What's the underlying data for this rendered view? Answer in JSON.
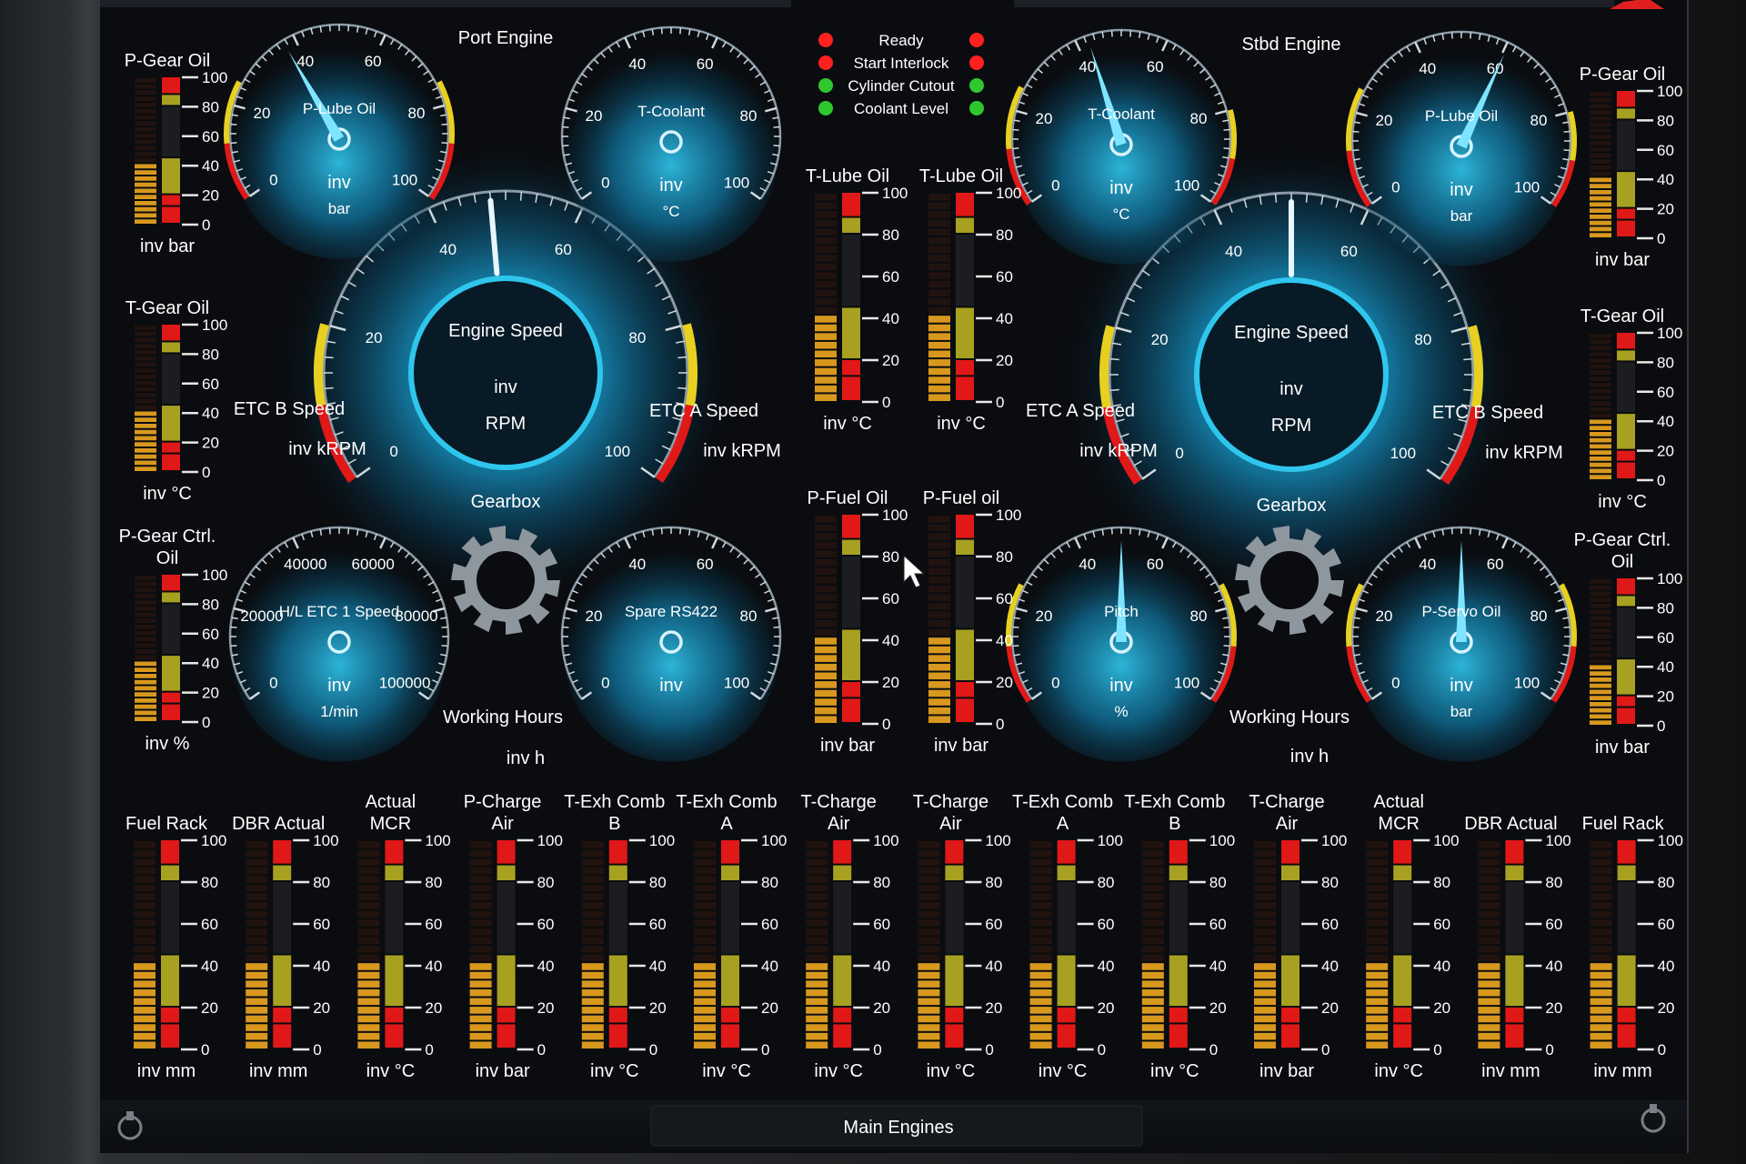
{
  "screen_title": "Main Engines",
  "status_indicators": [
    {
      "label": "Ready",
      "left_color": "#ff2020",
      "right_color": "#ff2020"
    },
    {
      "label": "Start Interlock",
      "left_color": "#ff2020",
      "right_color": "#ff2020"
    },
    {
      "label": "Cylinder Cutout",
      "left_color": "#2ec82e",
      "right_color": "#2ec82e"
    },
    {
      "label": "Coolant Level",
      "left_color": "#2ec82e",
      "right_color": "#2ec82e"
    }
  ],
  "port": {
    "title": "Port Engine",
    "engine_speed": {
      "label": "Engine Speed",
      "value": "inv",
      "unit": "RPM",
      "ticks": [
        "0",
        "20",
        "40",
        "60",
        "80",
        "100"
      ],
      "needle": 0.48
    },
    "etc_left": {
      "label": "ETC B Speed",
      "value": "inv kRPM"
    },
    "etc_right": {
      "label": "ETC A Speed",
      "value": "inv kRPM"
    },
    "gearbox_label": "Gearbox",
    "working_hours": {
      "label": "Working Hours",
      "value": "inv h"
    },
    "gauge_lube": {
      "label": "P-Lube Oil",
      "value": "inv",
      "unit": "bar",
      "ticks": [
        "0",
        "20",
        "40",
        "60",
        "80",
        "100"
      ],
      "needle": 0.38
    },
    "gauge_coolant": {
      "label": "T-Coolant",
      "value": "inv",
      "unit": "°C",
      "ticks": [
        "0",
        "20",
        "40",
        "60",
        "80",
        "100"
      ],
      "needle": null
    },
    "gauge_etc1": {
      "label": "H/L ETC 1 Speed",
      "value": "inv",
      "unit": "1/min",
      "ticks": [
        "0",
        "20000",
        "40000",
        "60000",
        "80000",
        "100000"
      ],
      "needle": null
    },
    "gauge_rs422": {
      "label": "Spare RS422",
      "value": "inv",
      "unit": "",
      "ticks": [
        "0",
        "20",
        "40",
        "60",
        "80",
        "100"
      ],
      "needle": null
    }
  },
  "stbd": {
    "title": "Stbd Engine",
    "engine_speed": {
      "label": "Engine Speed",
      "value": "inv",
      "unit": "RPM",
      "ticks": [
        "0",
        "20",
        "40",
        "60",
        "80",
        "100"
      ],
      "needle": 0.5
    },
    "etc_left": {
      "label": "ETC A Speed",
      "value": "inv kRPM"
    },
    "etc_right": {
      "label": "ETC B Speed",
      "value": "inv kRPM"
    },
    "gearbox_label": "Gearbox",
    "working_hours": {
      "label": "Working Hours",
      "value": "inv h"
    },
    "gauge_coolant": {
      "label": "T-Coolant",
      "value": "inv",
      "unit": "°C",
      "ticks": [
        "0",
        "20",
        "40",
        "60",
        "80",
        "100"
      ],
      "needle": 0.43
    },
    "gauge_lube": {
      "label": "P-Lube Oil",
      "value": "inv",
      "unit": "bar",
      "ticks": [
        "0",
        "20",
        "40",
        "60",
        "80",
        "100"
      ],
      "needle": 0.6
    },
    "gauge_pitch": {
      "label": "Pitch",
      "value": "inv",
      "unit": "%",
      "ticks": [
        "0",
        "20",
        "40",
        "60",
        "80",
        "100"
      ],
      "needle": 0.5
    },
    "gauge_servo": {
      "label": "P-Servo Oil",
      "value": "inv",
      "unit": "bar",
      "ticks": [
        "0",
        "20",
        "40",
        "60",
        "80",
        "100"
      ],
      "needle": 0.5
    }
  },
  "bar_scale": [
    "0",
    "20",
    "40",
    "60",
    "80",
    "100"
  ],
  "side_bars": {
    "left": [
      {
        "label": "P-Gear Oil",
        "value": "inv bar"
      },
      {
        "label": "T-Gear Oil",
        "value": "inv °C"
      },
      {
        "label": "P-Gear Ctrl. Oil",
        "value": "inv %"
      }
    ],
    "right": [
      {
        "label": "P-Gear Oil",
        "value": "inv bar"
      },
      {
        "label": "T-Gear Oil",
        "value": "inv °C"
      },
      {
        "label": "P-Gear Ctrl. Oil",
        "value": "inv bar"
      }
    ]
  },
  "center_bars": [
    {
      "label": "T-Lube Oil",
      "value": "inv °C"
    },
    {
      "label": "T-Lube Oil",
      "value": "inv °C"
    },
    {
      "label": "P-Fuel Oil",
      "value": "inv bar"
    },
    {
      "label": "P-Fuel oil",
      "value": "inv bar"
    }
  ],
  "bottom_bars": [
    {
      "label": "Fuel Rack",
      "value": "inv mm"
    },
    {
      "label": "DBR Actual",
      "value": "inv mm"
    },
    {
      "label": "Actual MCR",
      "value": "inv °C"
    },
    {
      "label": "P-Charge Air",
      "value": "inv bar"
    },
    {
      "label": "T-Exh Comb B",
      "value": "inv °C"
    },
    {
      "label": "T-Exh Comb A",
      "value": "inv °C"
    },
    {
      "label": "T-Charge Air",
      "value": "inv °C"
    },
    {
      "label": "T-Charge Air",
      "value": "inv °C"
    },
    {
      "label": "T-Exh Comb A",
      "value": "inv °C"
    },
    {
      "label": "T-Exh Comb B",
      "value": "inv °C"
    },
    {
      "label": "T-Charge Air",
      "value": "inv bar"
    },
    {
      "label": "Actual MCR",
      "value": "inv °C"
    },
    {
      "label": "DBR Actual",
      "value": "inv mm"
    },
    {
      "label": "Fuel Rack",
      "value": "inv mm"
    }
  ],
  "colors": {
    "accent": "#2fc6ee",
    "alarm_red": "#e01818",
    "warn_yellow": "#e8d020",
    "bar_orange": "#e4a020",
    "bar_olive": "#a8a020"
  }
}
